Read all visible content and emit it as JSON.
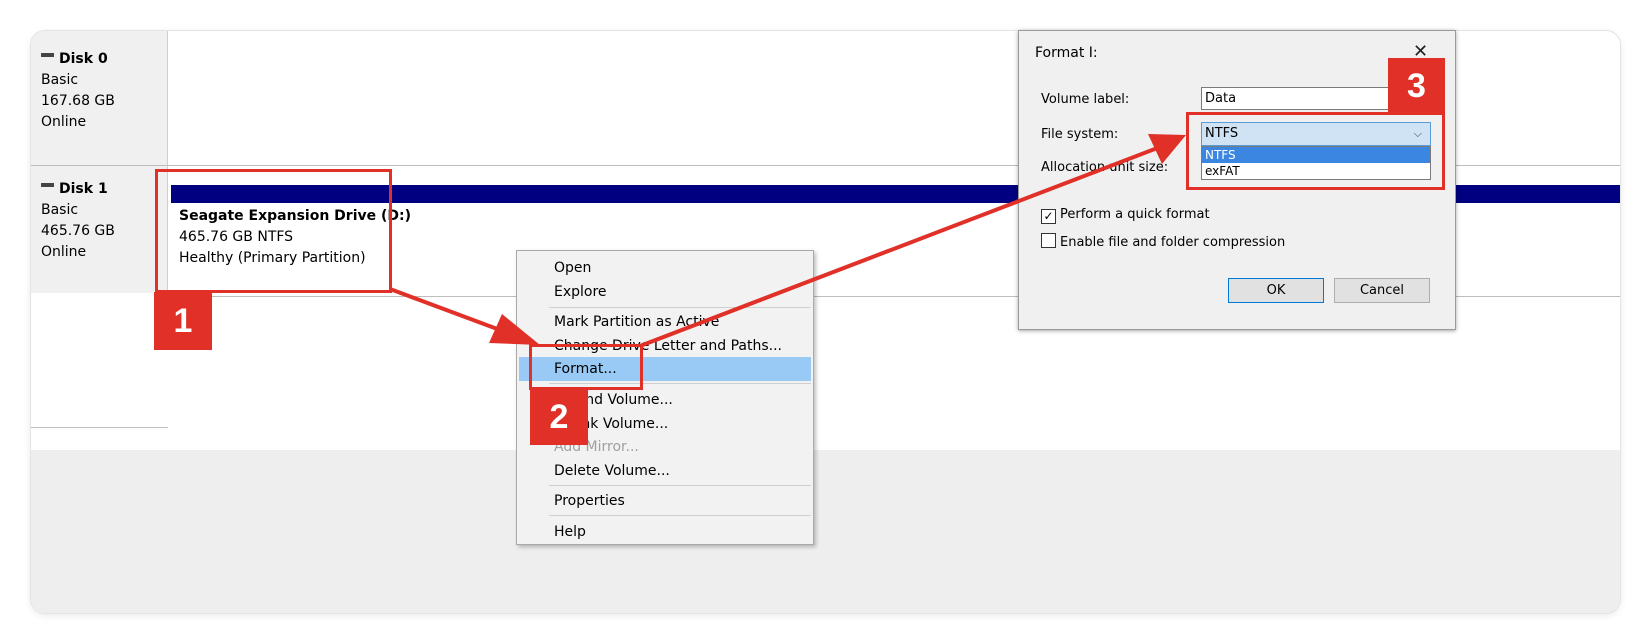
{
  "disks": [
    {
      "name": "Disk 0",
      "type": "Basic",
      "size": "167.68 GB",
      "status": "Online"
    },
    {
      "name": "Disk 1",
      "type": "Basic",
      "size": "465.76 GB",
      "status": "Online"
    }
  ],
  "partition": {
    "title": "Seagate Expansion Drive  (D:)",
    "size_fs": "465.76 GB NTFS",
    "status": "Healthy (Primary Partition)"
  },
  "context_menu": {
    "items": [
      {
        "label": "Open",
        "disabled": false
      },
      {
        "label": "Explore",
        "disabled": false
      },
      {
        "label": "Mark Partition as Active",
        "disabled": false
      },
      {
        "label": "Change Drive Letter and Paths...",
        "disabled": false
      },
      {
        "label": "Format...",
        "disabled": false,
        "highlighted": true
      },
      {
        "label": "Extend Volume...",
        "disabled": false
      },
      {
        "label": "Shrink Volume...",
        "disabled": false
      },
      {
        "label": "Add Mirror...",
        "disabled": true
      },
      {
        "label": "Delete Volume...",
        "disabled": false
      },
      {
        "label": "Properties",
        "disabled": false
      },
      {
        "label": "Help",
        "disabled": false
      }
    ]
  },
  "format_dialog": {
    "title": "Format I:",
    "close_glyph": "✕",
    "volume_label_label": "Volume label:",
    "volume_label_value": "Data",
    "file_system_label": "File system:",
    "file_system_value": "NTFS",
    "file_system_options": [
      "NTFS",
      "exFAT"
    ],
    "allocation_label": "Allocation unit size:",
    "quick_format_label": "Perform a quick format",
    "quick_format_checked": true,
    "compression_label": "Enable file and folder compression",
    "compression_checked": false,
    "ok_label": "OK",
    "cancel_label": "Cancel"
  },
  "annotations": {
    "steps": [
      "1",
      "2",
      "3"
    ],
    "color": "#e03027"
  },
  "colors": {
    "disk_strip": "#000080",
    "menu_highlight": "#99c9f5",
    "dropdown_selected": "#3b86e0"
  },
  "icons": {
    "disk": "disk-icon",
    "close": "close-icon",
    "chevron": "chevron-down-icon",
    "check": "checkmark-icon"
  }
}
